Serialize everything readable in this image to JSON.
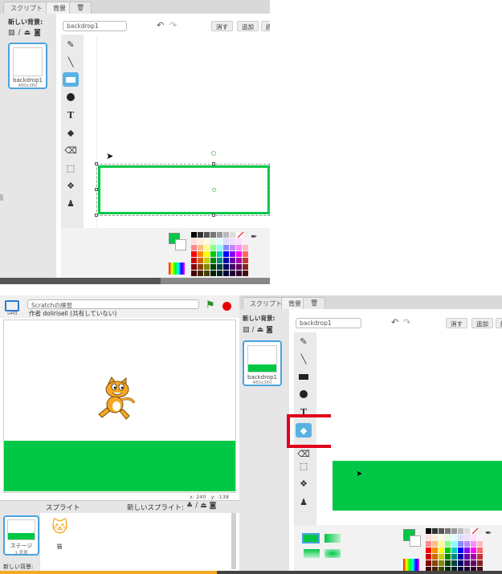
{
  "top": {
    "tabs": [
      "スクリプト",
      "背景",
      "🗑"
    ],
    "new_backdrop_label": "新しい背景:",
    "backdrop": {
      "name": "backdrop1",
      "size": "480x360"
    },
    "name_field": "backdrop1",
    "buttons": {
      "clear": "消す",
      "add": "追加",
      "import": "読"
    },
    "tools": [
      "brush",
      "line",
      "rectangle",
      "ellipse",
      "text",
      "fill",
      "eraser",
      "select",
      "select-duplicate",
      "stamp"
    ]
  },
  "bottom": {
    "project_title": "Scratchの練習",
    "author_line": "作者 dolirisell (共有していない)",
    "stage_coords": {
      "x_label": "x:",
      "x": "240",
      "y_label": "y:",
      "y": "-138"
    },
    "sprites_label": "スプライト",
    "new_sprite_label": "新しいスプライト:",
    "stage_thumb": {
      "name": "ステージ",
      "count": "1 背景"
    },
    "sprite_thumb": {
      "name": "猫"
    },
    "new_backdrop_footer": "新しい背景:",
    "tabs": [
      "スクリプト",
      "背景",
      "🗑"
    ],
    "new_backdrop_label": "新しい背景:",
    "backdrop": {
      "name": "backdrop1",
      "size": "480x360"
    },
    "name_field": "backdrop1",
    "buttons": {
      "clear": "消す",
      "add": "追加",
      "import": "読"
    }
  },
  "colors": {
    "accent_blue": "#4aa3df",
    "fill_green": "#00c846",
    "highlight_red": "#e0001b"
  }
}
